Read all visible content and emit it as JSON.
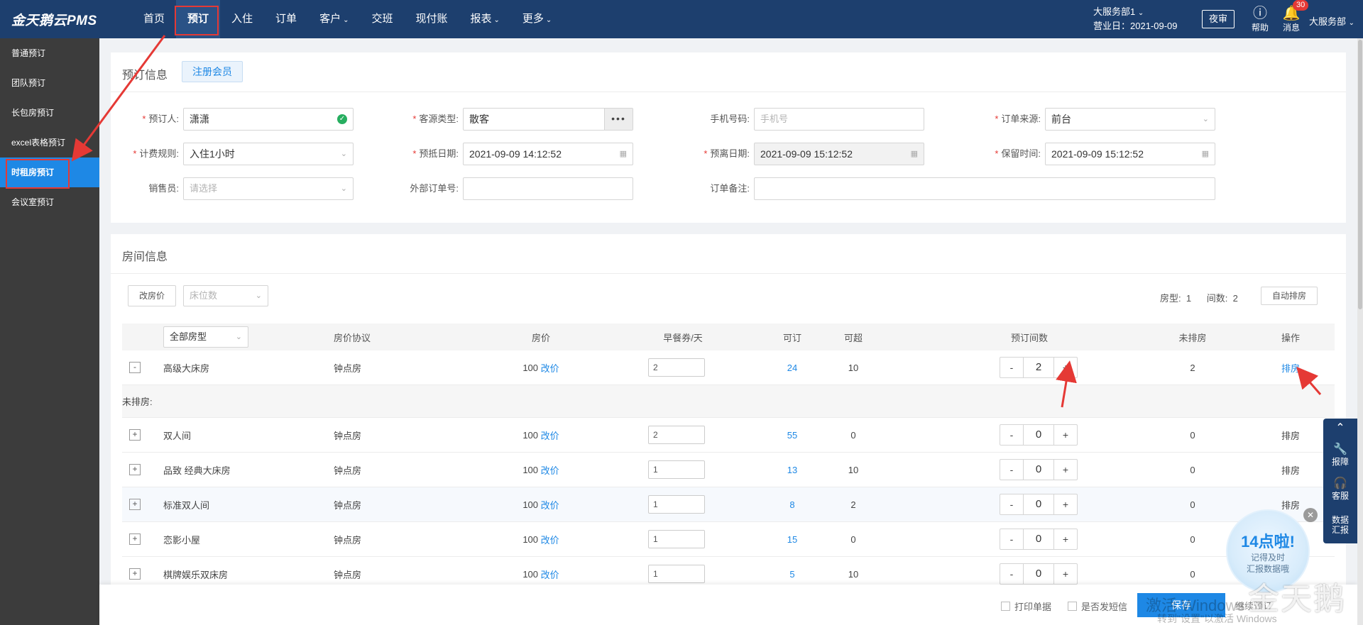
{
  "app": {
    "logo": "金天鹅云PMS"
  },
  "nav": [
    {
      "label": "首页",
      "caret": false
    },
    {
      "label": "预订",
      "caret": false,
      "active": true
    },
    {
      "label": "入住",
      "caret": false
    },
    {
      "label": "订单",
      "caret": false
    },
    {
      "label": "客户",
      "caret": true
    },
    {
      "label": "交班",
      "caret": false
    },
    {
      "label": "现付账",
      "caret": false
    },
    {
      "label": "报表",
      "caret": true
    },
    {
      "label": "更多",
      "caret": true
    }
  ],
  "header": {
    "dept": "大服务部1",
    "business_day": "营业日：2021-09-09",
    "night_audit": "夜审",
    "help": "帮助",
    "messages": "消息",
    "message_count": "30",
    "user": "大服务部"
  },
  "sidebar": [
    {
      "label": "普通预订"
    },
    {
      "label": "团队预订"
    },
    {
      "label": "长包房预订"
    },
    {
      "label": "excel表格预订"
    },
    {
      "label": "时租房预订",
      "active": true
    },
    {
      "label": "会议室预订"
    }
  ],
  "booking": {
    "title": "预订信息",
    "register_btn": "注册会员",
    "booker_label": "预订人:",
    "booker_value": "潇潇",
    "source_type_label": "客源类型:",
    "source_type_value": "散客",
    "phone_label": "手机号码:",
    "phone_placeholder": "手机号",
    "order_source_label": "订单来源:",
    "order_source_value": "前台",
    "billing_rule_label": "计费规则:",
    "billing_rule_value": "入住1小时",
    "arrival_label": "预抵日期:",
    "arrival_value": "2021-09-09 14:12:52",
    "departure_label": "预离日期:",
    "departure_value": "2021-09-09 15:12:52",
    "retain_label": "保留时间:",
    "retain_value": "2021-09-09 15:12:52",
    "sales_label": "销售员:",
    "sales_placeholder": "请选择",
    "ext_order_label": "外部订单号:",
    "ext_order_value": "",
    "remark_label": "订单备注:",
    "remark_value": ""
  },
  "rooms": {
    "title": "房间信息",
    "change_price_btn": "改房价",
    "bed_count_placeholder": "床位数",
    "room_type_label": "房型:",
    "room_type_count": "1",
    "room_count_label": "间数:",
    "room_count": "2",
    "auto_assign_btn": "自动排房",
    "columns": {
      "type_filter": "全部房型",
      "agreement": "房价协议",
      "price": "房价",
      "breakfast": "早餐券/天",
      "available": "可订",
      "overbook": "可超",
      "booked": "预订间数",
      "unassigned": "未排房",
      "action": "操作"
    },
    "unassigned_group_label": "未排房:",
    "price_change_link": "改价",
    "assign_link": "排房",
    "rows": [
      {
        "expander": "-",
        "name": "高级大床房",
        "agreement": "钟点房",
        "price": "100",
        "breakfast": "2",
        "available": "24",
        "overbook": "10",
        "booked": "2",
        "unassigned": "2",
        "action_active": true
      },
      {
        "expander": "+",
        "name": "双人间",
        "agreement": "钟点房",
        "price": "100",
        "breakfast": "2",
        "available": "55",
        "overbook": "0",
        "booked": "0",
        "unassigned": "0",
        "action_active": false
      },
      {
        "expander": "+",
        "name": "品致 经典大床房",
        "agreement": "钟点房",
        "price": "100",
        "breakfast": "1",
        "available": "13",
        "overbook": "10",
        "booked": "0",
        "unassigned": "0",
        "action_active": false
      },
      {
        "expander": "+",
        "name": "标准双人间",
        "agreement": "钟点房",
        "price": "100",
        "breakfast": "1",
        "available": "8",
        "overbook": "2",
        "booked": "0",
        "unassigned": "0",
        "action_active": false
      },
      {
        "expander": "+",
        "name": "恋影小屋",
        "agreement": "钟点房",
        "price": "100",
        "breakfast": "1",
        "available": "15",
        "overbook": "0",
        "booked": "0",
        "unassigned": "0",
        "action_active": false
      },
      {
        "expander": "+",
        "name": "棋牌娱乐双床房",
        "agreement": "钟点房",
        "price": "100",
        "breakfast": "1",
        "available": "5",
        "overbook": "10",
        "booked": "0",
        "unassigned": "0",
        "action_active": false
      }
    ]
  },
  "footer": {
    "print_label": "打印单据",
    "sms_label": "是否发短信",
    "save_btn": "保存",
    "continue_link": "继续预订",
    "activate_windows": "激活 Windows",
    "activate_hint": "转到\"设置\"以激活 Windows"
  },
  "floatbar": {
    "report": "报障",
    "service": "客服",
    "data_line1": "数据",
    "data_line2": "汇报"
  },
  "promo": {
    "headline": "14点啦!",
    "line1": "记得及时",
    "line2": "汇报数据哦"
  },
  "brand_watermark": "金天鹅",
  "colors": {
    "nav_bg": "#1d3f6e",
    "accent": "#1e88e5",
    "sidebar_bg": "#3c3c3c",
    "annotation": "#e53935"
  }
}
